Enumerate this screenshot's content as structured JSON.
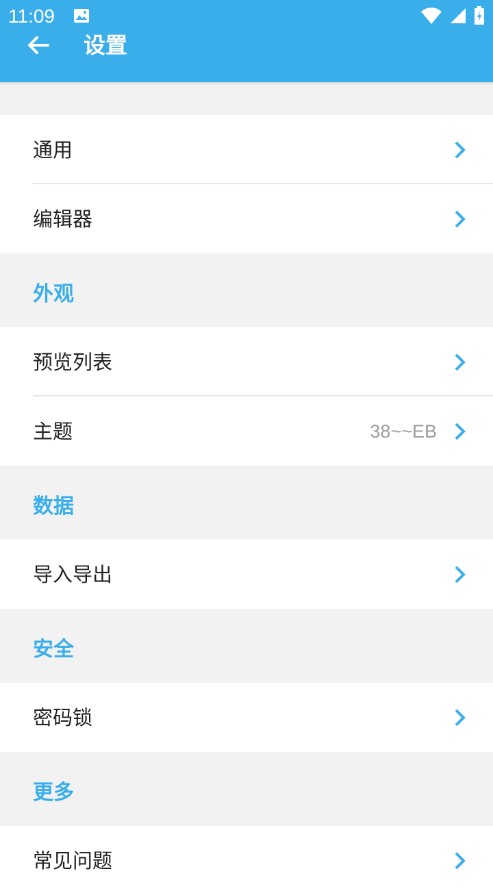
{
  "status_bar": {
    "time": "11:09"
  },
  "header": {
    "title": "设置"
  },
  "groups": [
    {
      "label": "",
      "items": [
        {
          "label": "通用"
        },
        {
          "label": "编辑器"
        }
      ]
    },
    {
      "label": "外观",
      "items": [
        {
          "label": "预览列表"
        },
        {
          "label": "主题",
          "value": "38~~EB"
        }
      ]
    },
    {
      "label": "数据",
      "items": [
        {
          "label": "导入导出"
        }
      ]
    },
    {
      "label": "安全",
      "items": [
        {
          "label": "密码锁"
        }
      ]
    },
    {
      "label": "更多",
      "items": [
        {
          "label": "常见问题"
        }
      ]
    }
  ],
  "colors": {
    "accent": "#3aaeea",
    "background": "#f2f2f2"
  }
}
